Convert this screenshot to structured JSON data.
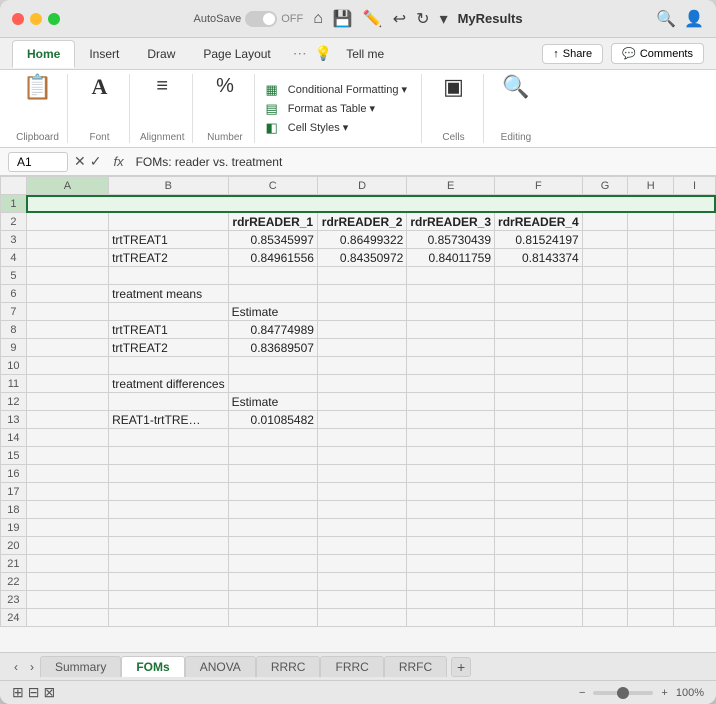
{
  "window": {
    "title": "MyResults"
  },
  "titlebar": {
    "autosave_label": "AutoSave",
    "toggle_state": "OFF",
    "app_name": "MyResults ▾"
  },
  "tabs": {
    "items": [
      "Home",
      "Insert",
      "Draw",
      "Page Layout",
      "Tell me"
    ],
    "active": "Home"
  },
  "ribbon": {
    "clipboard_label": "Clipboard",
    "font_label": "Font",
    "alignment_label": "Alignment",
    "number_label": "Number",
    "conditional_formatting": "Conditional Formatting",
    "format_as_table": "Format as Table",
    "cell_styles": "Cell Styles",
    "cells_label": "Cells",
    "editing_label": "Editing"
  },
  "formulabar": {
    "cell_ref": "A1",
    "formula": "FOMs: reader vs. treatment"
  },
  "share_btn": "Share",
  "comments_btn": "Comments",
  "grid": {
    "columns": [
      "",
      "A",
      "B",
      "C",
      "D",
      "E",
      "F",
      "G",
      "H",
      "I"
    ],
    "rows": [
      {
        "num": 1,
        "cells": [
          "",
          "FOMs: reader vs. treatment",
          "",
          "",
          "",
          "",
          "",
          "",
          ""
        ]
      },
      {
        "num": 2,
        "cells": [
          "",
          "",
          "rdrREADER_1",
          "rdrREADER_2",
          "rdrREADER_3",
          "rdrREADER_4",
          "",
          "",
          ""
        ]
      },
      {
        "num": 3,
        "cells": [
          "",
          "trtTREAT1",
          "0.85345997",
          "0.86499322",
          "0.85730439",
          "0.81524197",
          "",
          "",
          ""
        ]
      },
      {
        "num": 4,
        "cells": [
          "",
          "trtTREAT2",
          "0.84961556",
          "0.84350972",
          "0.84011759",
          "0.8143374",
          "",
          "",
          ""
        ]
      },
      {
        "num": 5,
        "cells": [
          "",
          "",
          "",
          "",
          "",
          "",
          "",
          "",
          ""
        ]
      },
      {
        "num": 6,
        "cells": [
          "",
          "treatment means",
          "",
          "",
          "",
          "",
          "",
          "",
          ""
        ]
      },
      {
        "num": 7,
        "cells": [
          "",
          "",
          "Estimate",
          "",
          "",
          "",
          "",
          "",
          ""
        ]
      },
      {
        "num": 8,
        "cells": [
          "",
          "trtTREAT1",
          "0.84774989",
          "",
          "",
          "",
          "",
          "",
          ""
        ]
      },
      {
        "num": 9,
        "cells": [
          "",
          "trtTREAT2",
          "0.83689507",
          "",
          "",
          "",
          "",
          "",
          ""
        ]
      },
      {
        "num": 10,
        "cells": [
          "",
          "",
          "",
          "",
          "",
          "",
          "",
          "",
          ""
        ]
      },
      {
        "num": 11,
        "cells": [
          "",
          "treatment differences",
          "",
          "",
          "",
          "",
          "",
          "",
          ""
        ]
      },
      {
        "num": 12,
        "cells": [
          "",
          "",
          "Estimate",
          "",
          "",
          "",
          "",
          "",
          ""
        ]
      },
      {
        "num": 13,
        "cells": [
          "",
          "REAT1-trtTRE…",
          "0.01085482",
          "",
          "",
          "",
          "",
          "",
          ""
        ]
      },
      {
        "num": 14,
        "cells": [
          "",
          "",
          "",
          "",
          "",
          "",
          "",
          "",
          ""
        ]
      },
      {
        "num": 15,
        "cells": [
          "",
          "",
          "",
          "",
          "",
          "",
          "",
          "",
          ""
        ]
      },
      {
        "num": 16,
        "cells": [
          "",
          "",
          "",
          "",
          "",
          "",
          "",
          "",
          ""
        ]
      },
      {
        "num": 17,
        "cells": [
          "",
          "",
          "",
          "",
          "",
          "",
          "",
          "",
          ""
        ]
      },
      {
        "num": 18,
        "cells": [
          "",
          "",
          "",
          "",
          "",
          "",
          "",
          "",
          ""
        ]
      },
      {
        "num": 19,
        "cells": [
          "",
          "",
          "",
          "",
          "",
          "",
          "",
          "",
          ""
        ]
      },
      {
        "num": 20,
        "cells": [
          "",
          "",
          "",
          "",
          "",
          "",
          "",
          "",
          ""
        ]
      },
      {
        "num": 21,
        "cells": [
          "",
          "",
          "",
          "",
          "",
          "",
          "",
          "",
          ""
        ]
      },
      {
        "num": 22,
        "cells": [
          "",
          "",
          "",
          "",
          "",
          "",
          "",
          "",
          ""
        ]
      },
      {
        "num": 23,
        "cells": [
          "",
          "",
          "",
          "",
          "",
          "",
          "",
          "",
          ""
        ]
      },
      {
        "num": 24,
        "cells": [
          "",
          "",
          "",
          "",
          "",
          "",
          "",
          "",
          ""
        ]
      }
    ]
  },
  "sheet_tabs": {
    "items": [
      "Summary",
      "FOMs",
      "ANOVA",
      "RRRC",
      "FRRC",
      "RRFC"
    ],
    "active": "FOMs"
  },
  "statusbar": {
    "zoom": "100%",
    "zoom_minus": "−",
    "zoom_plus": "+"
  }
}
